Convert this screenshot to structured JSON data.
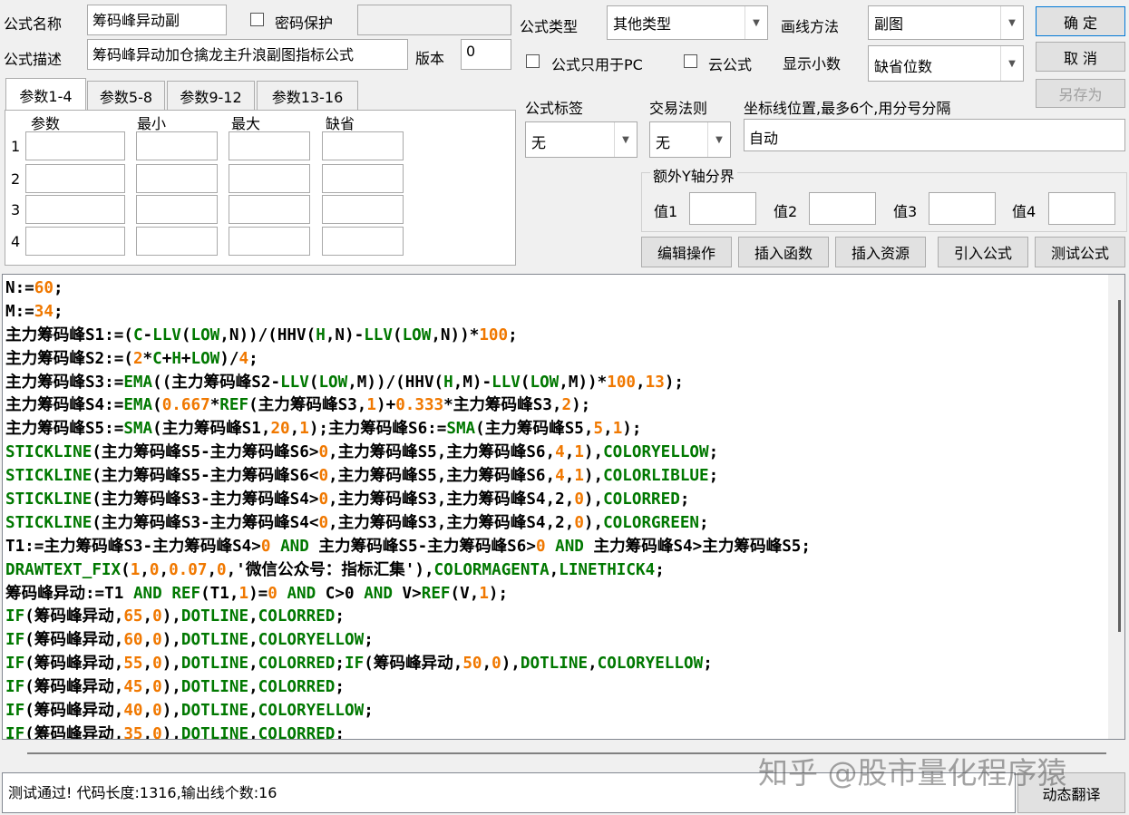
{
  "header": {
    "name_label": "公式名称",
    "name_value": "筹码峰异动副",
    "password_label": "密码保护",
    "password_value": "",
    "desc_label": "公式描述",
    "desc_value": "筹码峰异动加仓擒龙主升浪副图指标公式",
    "version_label": "版本",
    "version_value": "0",
    "type_label": "公式类型",
    "type_value": "其他类型",
    "draw_label": "画线方法",
    "draw_value": "副图",
    "pc_only_label": "公式只用于PC",
    "cloud_label": "云公式",
    "decimals_label": "显示小数",
    "decimals_value": "缺省位数"
  },
  "buttons": {
    "ok": "确 定",
    "cancel": "取 消",
    "save_as": "另存为",
    "edit_ops": "编辑操作",
    "insert_func": "插入函数",
    "insert_res": "插入资源",
    "import_formula": "引入公式",
    "test_formula": "测试公式",
    "dyn_translate": "动态翻译"
  },
  "tabs": [
    "参数1-4",
    "参数5-8",
    "参数9-12",
    "参数13-16"
  ],
  "params": {
    "headers": [
      "参数",
      "最小",
      "最大",
      "缺省"
    ],
    "rows": [
      "1",
      "2",
      "3",
      "4"
    ]
  },
  "tags": {
    "tag_label": "公式标签",
    "tag_value": "无",
    "rule_label": "交易法则",
    "rule_value": "无",
    "axis_label": "坐标线位置,最多6个,用分号分隔",
    "axis_value": "自动"
  },
  "yaxis": {
    "group_label": "额外Y轴分界",
    "v1": "值1",
    "v2": "值2",
    "v3": "值3",
    "v4": "值4"
  },
  "colors": {
    "black": "#000000",
    "number": "#f07800",
    "function": "#007800",
    "keyword": "#007800"
  },
  "code_lines": [
    [
      [
        "N:=",
        "k"
      ],
      [
        "60",
        "n"
      ],
      [
        ";",
        "k"
      ]
    ],
    [
      [
        "M:=",
        "k"
      ],
      [
        "34",
        "n"
      ],
      [
        ";",
        "k"
      ]
    ],
    [
      [
        "主力筹码峰S1:=(",
        "k"
      ],
      [
        "C",
        "f"
      ],
      [
        "-",
        "k"
      ],
      [
        "LLV",
        "f"
      ],
      [
        "(",
        "k"
      ],
      [
        "LOW",
        "f"
      ],
      [
        ",N))/(HHV(",
        "k"
      ],
      [
        "H",
        "f"
      ],
      [
        ",N)-",
        "k"
      ],
      [
        "LLV",
        "f"
      ],
      [
        "(",
        "k"
      ],
      [
        "LOW",
        "f"
      ],
      [
        ",N))*",
        "k"
      ],
      [
        "100",
        "n"
      ],
      [
        ";",
        "k"
      ]
    ],
    [
      [
        "主力筹码峰S2:=(",
        "k"
      ],
      [
        "2",
        "n"
      ],
      [
        "*",
        "k"
      ],
      [
        "C",
        "f"
      ],
      [
        "+",
        "k"
      ],
      [
        "H",
        "f"
      ],
      [
        "+",
        "k"
      ],
      [
        "LOW",
        "f"
      ],
      [
        ")/",
        "k"
      ],
      [
        "4",
        "n"
      ],
      [
        ";",
        "k"
      ]
    ],
    [
      [
        "主力筹码峰S3:=",
        "k"
      ],
      [
        "EMA",
        "f"
      ],
      [
        "((主力筹码峰S2-",
        "k"
      ],
      [
        "LLV",
        "f"
      ],
      [
        "(",
        "k"
      ],
      [
        "LOW",
        "f"
      ],
      [
        ",M))/(HHV(",
        "k"
      ],
      [
        "H",
        "f"
      ],
      [
        ",M)-",
        "k"
      ],
      [
        "LLV",
        "f"
      ],
      [
        "(",
        "k"
      ],
      [
        "LOW",
        "f"
      ],
      [
        ",M))*",
        "k"
      ],
      [
        "100",
        "n"
      ],
      [
        ",",
        "k"
      ],
      [
        "13",
        "n"
      ],
      [
        ");",
        "k"
      ]
    ],
    [
      [
        "主力筹码峰S4:=",
        "k"
      ],
      [
        "EMA",
        "f"
      ],
      [
        "(",
        "k"
      ],
      [
        "0.667",
        "n"
      ],
      [
        "*",
        "k"
      ],
      [
        "REF",
        "f"
      ],
      [
        "(主力筹码峰S3,",
        "k"
      ],
      [
        "1",
        "n"
      ],
      [
        ")+",
        "k"
      ],
      [
        "0.333",
        "n"
      ],
      [
        "*主力筹码峰S3,",
        "k"
      ],
      [
        "2",
        "n"
      ],
      [
        ");",
        "k"
      ]
    ],
    [
      [
        "主力筹码峰S5:=",
        "k"
      ],
      [
        "SMA",
        "f"
      ],
      [
        "(主力筹码峰S1,",
        "k"
      ],
      [
        "20",
        "n"
      ],
      [
        ",",
        "k"
      ],
      [
        "1",
        "n"
      ],
      [
        ");主力筹码峰S6:=",
        "k"
      ],
      [
        "SMA",
        "f"
      ],
      [
        "(主力筹码峰S5,",
        "k"
      ],
      [
        "5",
        "n"
      ],
      [
        ",",
        "k"
      ],
      [
        "1",
        "n"
      ],
      [
        ");",
        "k"
      ]
    ],
    [
      [
        "STICKLINE",
        "f"
      ],
      [
        "(主力筹码峰S5-主力筹码峰S6>",
        "k"
      ],
      [
        "0",
        "n"
      ],
      [
        ",主力筹码峰S5,主力筹码峰S6,",
        "k"
      ],
      [
        "4",
        "n"
      ],
      [
        ",",
        "k"
      ],
      [
        "1",
        "n"
      ],
      [
        "),",
        "k"
      ],
      [
        "COLORYELLOW",
        "f"
      ],
      [
        ";",
        "k"
      ]
    ],
    [
      [
        "STICKLINE",
        "f"
      ],
      [
        "(主力筹码峰S5-主力筹码峰S6<",
        "k"
      ],
      [
        "0",
        "n"
      ],
      [
        ",主力筹码峰S5,主力筹码峰S6,",
        "k"
      ],
      [
        "4",
        "n"
      ],
      [
        ",",
        "k"
      ],
      [
        "1",
        "n"
      ],
      [
        "),",
        "k"
      ],
      [
        "COLORLIBLUE",
        "f"
      ],
      [
        ";",
        "k"
      ]
    ],
    [
      [
        "STICKLINE",
        "f"
      ],
      [
        "(主力筹码峰S3-主力筹码峰S4>",
        "k"
      ],
      [
        "0",
        "n"
      ],
      [
        ",主力筹码峰S3,主力筹码峰S4,",
        "k"
      ],
      [
        "2",
        "k"
      ],
      [
        ",",
        "k"
      ],
      [
        "0",
        "n"
      ],
      [
        "),",
        "k"
      ],
      [
        "COLORRED",
        "f"
      ],
      [
        ";",
        "k"
      ]
    ],
    [
      [
        "STICKLINE",
        "f"
      ],
      [
        "(主力筹码峰S3-主力筹码峰S4<",
        "k"
      ],
      [
        "0",
        "n"
      ],
      [
        ",主力筹码峰S3,主力筹码峰S4,",
        "k"
      ],
      [
        "2",
        "k"
      ],
      [
        ",",
        "k"
      ],
      [
        "0",
        "n"
      ],
      [
        "),",
        "k"
      ],
      [
        "COLORGREEN",
        "f"
      ],
      [
        ";",
        "k"
      ]
    ],
    [
      [
        "T1:=主力筹码峰S3-主力筹码峰S4>",
        "k"
      ],
      [
        "0",
        "n"
      ],
      [
        " ",
        "k"
      ],
      [
        "AND",
        "f"
      ],
      [
        " 主力筹码峰S5-主力筹码峰S6>",
        "k"
      ],
      [
        "0",
        "n"
      ],
      [
        " ",
        "k"
      ],
      [
        "AND",
        "f"
      ],
      [
        " 主力筹码峰S4>主力筹码峰S5;",
        "k"
      ]
    ],
    [
      [
        "DRAWTEXT_FIX",
        "f"
      ],
      [
        "(",
        "k"
      ],
      [
        "1",
        "n"
      ],
      [
        ",",
        "k"
      ],
      [
        "0",
        "n"
      ],
      [
        ",",
        "k"
      ],
      [
        "0.07",
        "n"
      ],
      [
        ",",
        "k"
      ],
      [
        "0",
        "n"
      ],
      [
        ",'微信公众号：指标汇集'),",
        "k"
      ],
      [
        "COLORMAGENTA",
        "f"
      ],
      [
        ",",
        "k"
      ],
      [
        "LINETHICK4",
        "f"
      ],
      [
        ";",
        "k"
      ]
    ],
    [
      [
        "筹码峰异动:=T1 ",
        "k"
      ],
      [
        "AND",
        "f"
      ],
      [
        " ",
        "k"
      ],
      [
        "REF",
        "f"
      ],
      [
        "(T1,",
        "k"
      ],
      [
        "1",
        "n"
      ],
      [
        ")=",
        "k"
      ],
      [
        "0",
        "n"
      ],
      [
        " ",
        "k"
      ],
      [
        "AND",
        "f"
      ],
      [
        " C>0 ",
        "k"
      ],
      [
        "AND",
        "f"
      ],
      [
        " V>",
        "k"
      ],
      [
        "REF",
        "f"
      ],
      [
        "(V,",
        "k"
      ],
      [
        "1",
        "n"
      ],
      [
        ");",
        "k"
      ]
    ],
    [
      [
        "IF",
        "f"
      ],
      [
        "(筹码峰异动,",
        "k"
      ],
      [
        "65",
        "n"
      ],
      [
        ",",
        "k"
      ],
      [
        "0",
        "n"
      ],
      [
        "),",
        "k"
      ],
      [
        "DOTLINE",
        "f"
      ],
      [
        ",",
        "k"
      ],
      [
        "COLORRED",
        "f"
      ],
      [
        ";",
        "k"
      ]
    ],
    [
      [
        "IF",
        "f"
      ],
      [
        "(筹码峰异动,",
        "k"
      ],
      [
        "60",
        "n"
      ],
      [
        ",",
        "k"
      ],
      [
        "0",
        "n"
      ],
      [
        "),",
        "k"
      ],
      [
        "DOTLINE",
        "f"
      ],
      [
        ",",
        "k"
      ],
      [
        "COLORYELLOW",
        "f"
      ],
      [
        ";",
        "k"
      ]
    ],
    [
      [
        "IF",
        "f"
      ],
      [
        "(筹码峰异动,",
        "k"
      ],
      [
        "55",
        "n"
      ],
      [
        ",",
        "k"
      ],
      [
        "0",
        "n"
      ],
      [
        "),",
        "k"
      ],
      [
        "DOTLINE",
        "f"
      ],
      [
        ",",
        "k"
      ],
      [
        "COLORRED",
        "f"
      ],
      [
        ";",
        "k"
      ],
      [
        "IF",
        "f"
      ],
      [
        "(筹码峰异动,",
        "k"
      ],
      [
        "50",
        "n"
      ],
      [
        ",",
        "k"
      ],
      [
        "0",
        "n"
      ],
      [
        "),",
        "k"
      ],
      [
        "DOTLINE",
        "f"
      ],
      [
        ",",
        "k"
      ],
      [
        "COLORYELLOW",
        "f"
      ],
      [
        ";",
        "k"
      ]
    ],
    [
      [
        "IF",
        "f"
      ],
      [
        "(筹码峰异动,",
        "k"
      ],
      [
        "45",
        "n"
      ],
      [
        ",",
        "k"
      ],
      [
        "0",
        "n"
      ],
      [
        "),",
        "k"
      ],
      [
        "DOTLINE",
        "f"
      ],
      [
        ",",
        "k"
      ],
      [
        "COLORRED",
        "f"
      ],
      [
        ";",
        "k"
      ]
    ],
    [
      [
        "IF",
        "f"
      ],
      [
        "(筹码峰异动,",
        "k"
      ],
      [
        "40",
        "n"
      ],
      [
        ",",
        "k"
      ],
      [
        "0",
        "n"
      ],
      [
        "),",
        "k"
      ],
      [
        "DOTLINE",
        "f"
      ],
      [
        ",",
        "k"
      ],
      [
        "COLORYELLOW",
        "f"
      ],
      [
        ";",
        "k"
      ]
    ],
    [
      [
        "IF",
        "f"
      ],
      [
        "(筹码峰异动,",
        "k"
      ],
      [
        "35",
        "n"
      ],
      [
        ",",
        "k"
      ],
      [
        "0",
        "n"
      ],
      [
        "),",
        "k"
      ],
      [
        "DOTLINE",
        "f"
      ],
      [
        ",",
        "k"
      ],
      [
        "COLORRED",
        "f"
      ],
      [
        ";",
        "k"
      ]
    ]
  ],
  "status_text": "测试通过! 代码长度:1316,输出线个数:16",
  "watermark": "知乎 @股市量化程序猿"
}
